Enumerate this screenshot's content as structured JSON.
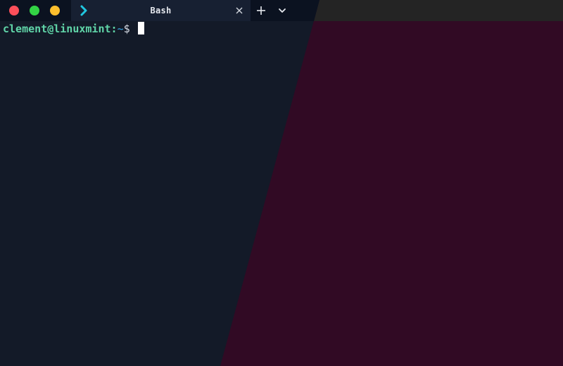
{
  "window": {
    "controls": {
      "close_color": "#fc4f5a",
      "maximize_color": "#33d445",
      "minimize_color": "#fdbf2d"
    }
  },
  "tabs": [
    {
      "title": "Bash",
      "icon": "chevron-right-icon",
      "active": true
    }
  ],
  "tabbar": {
    "new_tab_icon": "plus-icon",
    "menu_icon": "chevron-down-icon"
  },
  "terminal": {
    "prompt": {
      "user_host": "clement@linuxmint",
      "separator": ":",
      "path": "~",
      "symbol": "$ "
    },
    "colors": {
      "user_host": "#60d5a8",
      "path": "#39a8e6",
      "cursor": "#ffffff",
      "background": "#131a28"
    }
  }
}
